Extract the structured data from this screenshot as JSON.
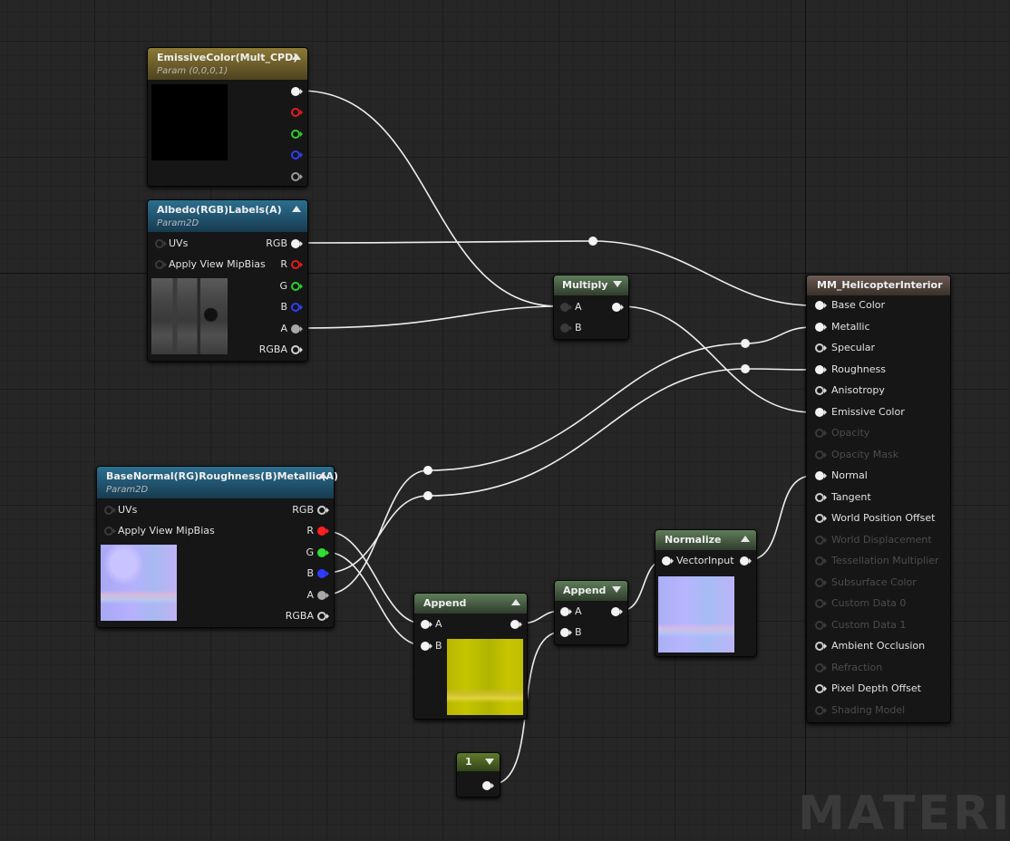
{
  "watermark": "MATERIA",
  "emissive_param": {
    "title": "EmissiveColor(Mult_CPD)",
    "subtitle": "Param (0,0,0,1)",
    "preview_color": "#000000"
  },
  "albedo_tex": {
    "title": "Albedo(RGB)Labels(A)",
    "subtitle": "Param2D",
    "inputs": [
      "UVs",
      "Apply View MipBias"
    ],
    "outputs": [
      "RGB",
      "R",
      "G",
      "B",
      "A",
      "RGBA"
    ]
  },
  "base_normal_tex": {
    "title": "BaseNormal(RG)Roughness(B)Metallic(A)",
    "subtitle": "Param2D",
    "inputs": [
      "UVs",
      "Apply View MipBias"
    ],
    "outputs": [
      "RGB",
      "R",
      "G",
      "B",
      "A",
      "RGBA"
    ]
  },
  "multiply": {
    "title": "Multiply",
    "inputs": [
      "A",
      "B"
    ]
  },
  "append1": {
    "title": "Append",
    "inputs": [
      "A",
      "B"
    ]
  },
  "append2": {
    "title": "Append",
    "inputs": [
      "A",
      "B"
    ]
  },
  "normalize": {
    "title": "Normalize",
    "input": "VectorInput"
  },
  "constant": {
    "value": "1"
  },
  "result": {
    "title": "MM_HelicopterInterior",
    "pins": [
      "Base Color",
      "Metallic",
      "Specular",
      "Roughness",
      "Anisotropy",
      "Emissive Color",
      "Opacity",
      "Opacity Mask",
      "Normal",
      "Tangent",
      "World Position Offset",
      "World Displacement",
      "Tessellation Multiplier",
      "Subsurface Color",
      "Custom Data 0",
      "Custom Data 1",
      "Ambient Occlusion",
      "Refraction",
      "Pixel Depth Offset",
      "Shading Model"
    ]
  },
  "colors": {
    "background": "#262626",
    "wire": "#f0f0f0",
    "red_channel": "#ff2020",
    "green_channel": "#30e030",
    "blue_channel": "#2d3cff"
  }
}
